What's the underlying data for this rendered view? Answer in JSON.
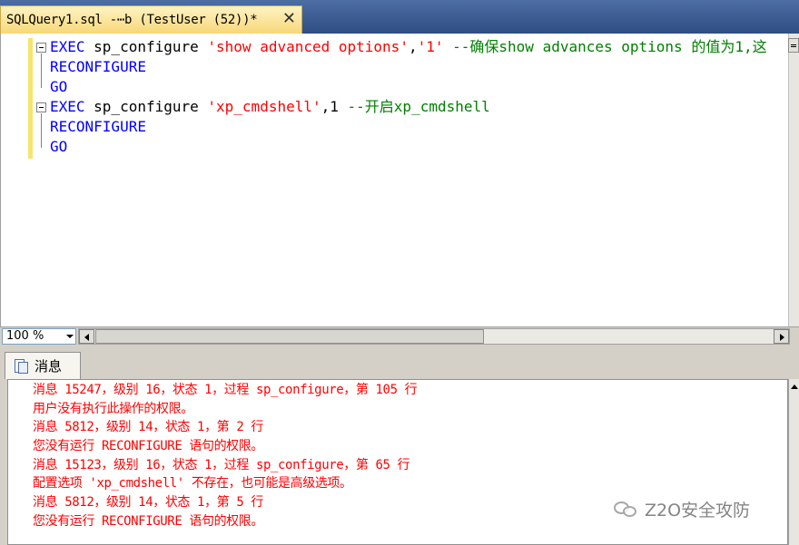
{
  "tab": {
    "title": "SQLQuery1.sql -⋯b (TestUser (52))*",
    "close": "✕"
  },
  "editor": {
    "lines": [
      {
        "kw1": "EXEC",
        "plain1": " sp_configure ",
        "str1": "'show advanced options'",
        "plain2": ",",
        "str2": "'1'",
        "cm": " --确保show advances options 的值为1,这"
      },
      {
        "kw1": "RECONFIGURE"
      },
      {
        "kw1": "GO"
      },
      {
        "kw1": "EXEC",
        "plain1": " sp_configure ",
        "str1": "'xp_cmdshell'",
        "plain2": ",1 ",
        "cm": "--开启xp_cmdshell"
      },
      {
        "kw1": "RECONFIGURE"
      },
      {
        "kw1": "GO"
      }
    ]
  },
  "zoom": {
    "value": "100 %"
  },
  "results": {
    "tab_label": "消息",
    "messages": [
      "消息 15247，级别 16，状态 1，过程 sp_configure，第 105 行",
      "用户没有执行此操作的权限。",
      "消息 5812，级别 14，状态 1，第 2 行",
      "您没有运行 RECONFIGURE 语句的权限。",
      "消息 15123，级别 16，状态 1，过程 sp_configure，第 65 行",
      "配置选项 'xp_cmdshell' 不存在，也可能是高级选项。",
      "消息 5812，级别 14，状态 1，第 5 行",
      "您没有运行 RECONFIGURE 语句的权限。"
    ]
  },
  "watermark": {
    "text": "Z2O安全攻防"
  },
  "colors": {
    "keyword": "#0000ff",
    "string": "#ff0000",
    "comment": "#008000",
    "error": "#ff0000",
    "tab_active": "#f7d878"
  }
}
